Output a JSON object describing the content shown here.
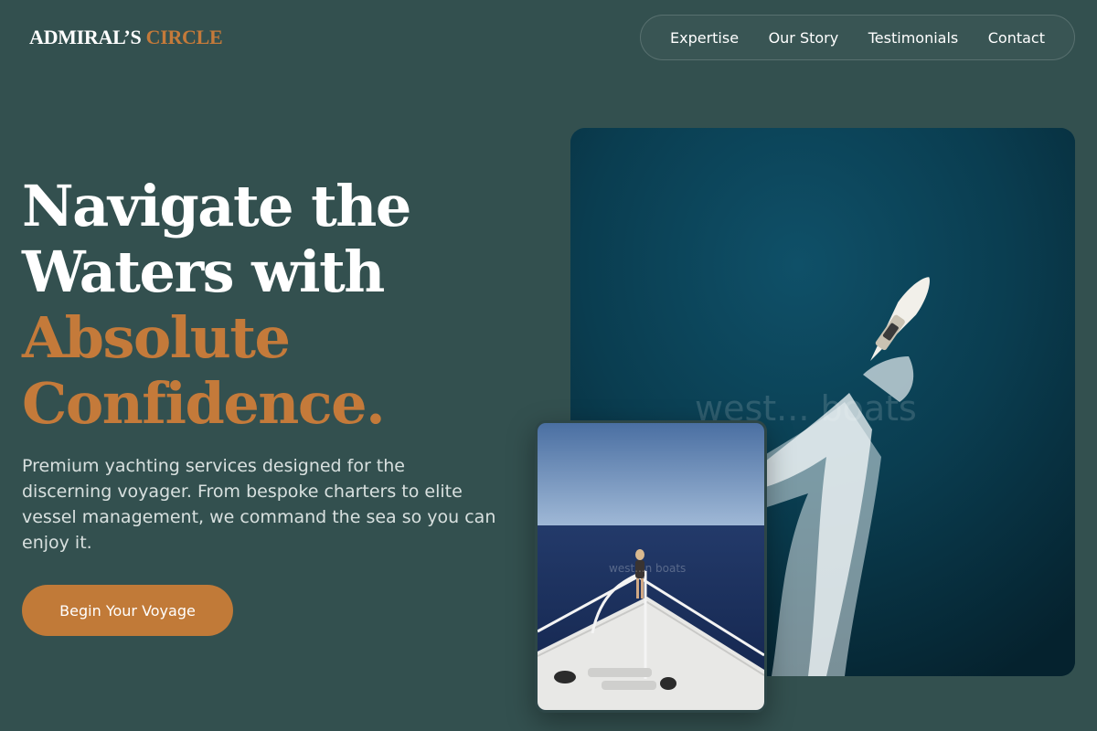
{
  "brand": {
    "name_part1": "ADMIRAL’S",
    "name_part2": "CIRCLE"
  },
  "nav": {
    "items": [
      "Expertise",
      "Our Story",
      "Testimonials",
      "Contact"
    ]
  },
  "hero": {
    "headline_line1": "Navigate the",
    "headline_line2": "Waters with",
    "headline_accent_line1": "Absolute",
    "headline_accent_line2": "Confidence.",
    "subtext": "Premium yachting services designed for the discerning voyager. From bespoke charters to elite vessel management, we command the sea so you can enjoy it.",
    "cta_label": "Begin Your Voyage"
  },
  "images": {
    "main": {
      "subject": "aerial view of yacht with wake on open sea",
      "watermark": "west... boats"
    },
    "inset": {
      "subject": "woman standing at bow of yacht on deep blue sea",
      "watermark": "west...n boats"
    }
  },
  "colors": {
    "background": "#33504f",
    "accent": "#c47a3a",
    "button": "#c17a38",
    "text": "#ffffff",
    "subtext": "#d8e0df"
  }
}
